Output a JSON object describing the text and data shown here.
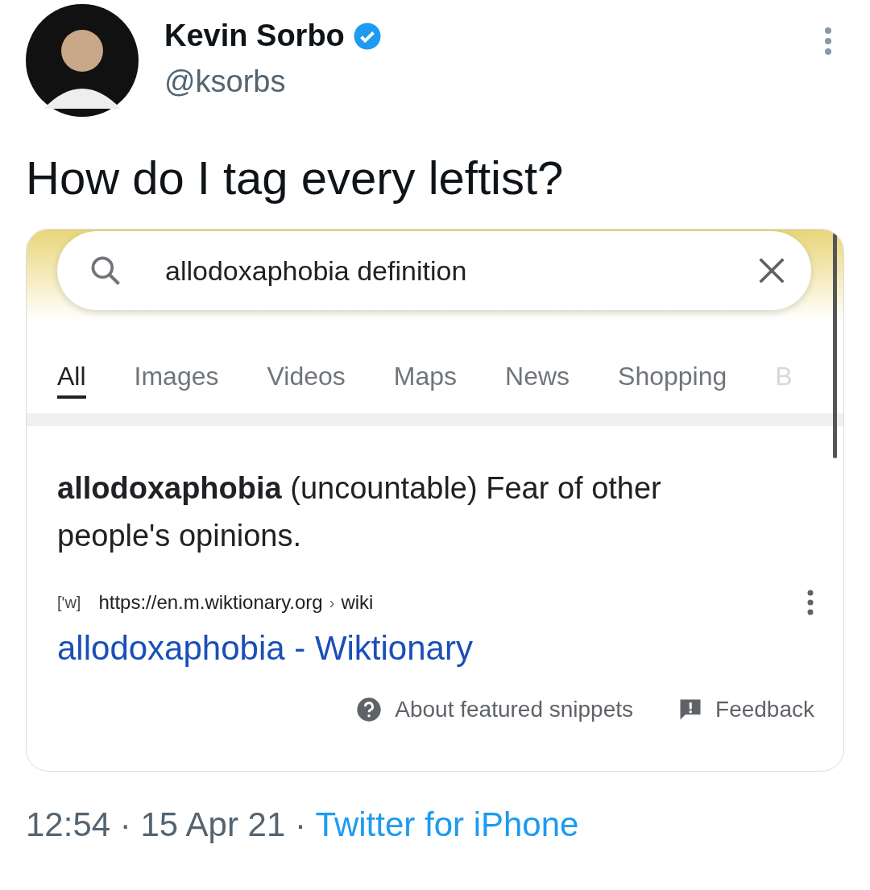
{
  "author": {
    "name": "Kevin Sorbo",
    "verified": true,
    "handle": "@ksorbs"
  },
  "tweet_text": "How do I tag every leftist?",
  "embedded_screenshot": {
    "search": {
      "value": "allodoxaphobia definition"
    },
    "tabs": [
      {
        "label": "All",
        "selected": true
      },
      {
        "label": "Images",
        "selected": false
      },
      {
        "label": "Videos",
        "selected": false
      },
      {
        "label": "Maps",
        "selected": false
      },
      {
        "label": "News",
        "selected": false
      },
      {
        "label": "Shopping",
        "selected": false
      },
      {
        "label": "B",
        "selected": false
      }
    ],
    "snippet": {
      "text": "**allodoxaphobia** (uncountable) Fear of other people's opinions."
    },
    "source": {
      "favicon": "['w]",
      "url": "https://en.m.wiktionary.org",
      "separator": "›",
      "path": "wiki"
    },
    "result_title": "allodoxaphobia - Wiktionary",
    "footer": [
      "About featured snippets",
      "Feedback"
    ]
  },
  "timestamp": {
    "time": "12:54",
    "separator_1": "·",
    "date": "15 Apr 21",
    "separator_2": "·",
    "client": "Twitter for iPhone"
  }
}
